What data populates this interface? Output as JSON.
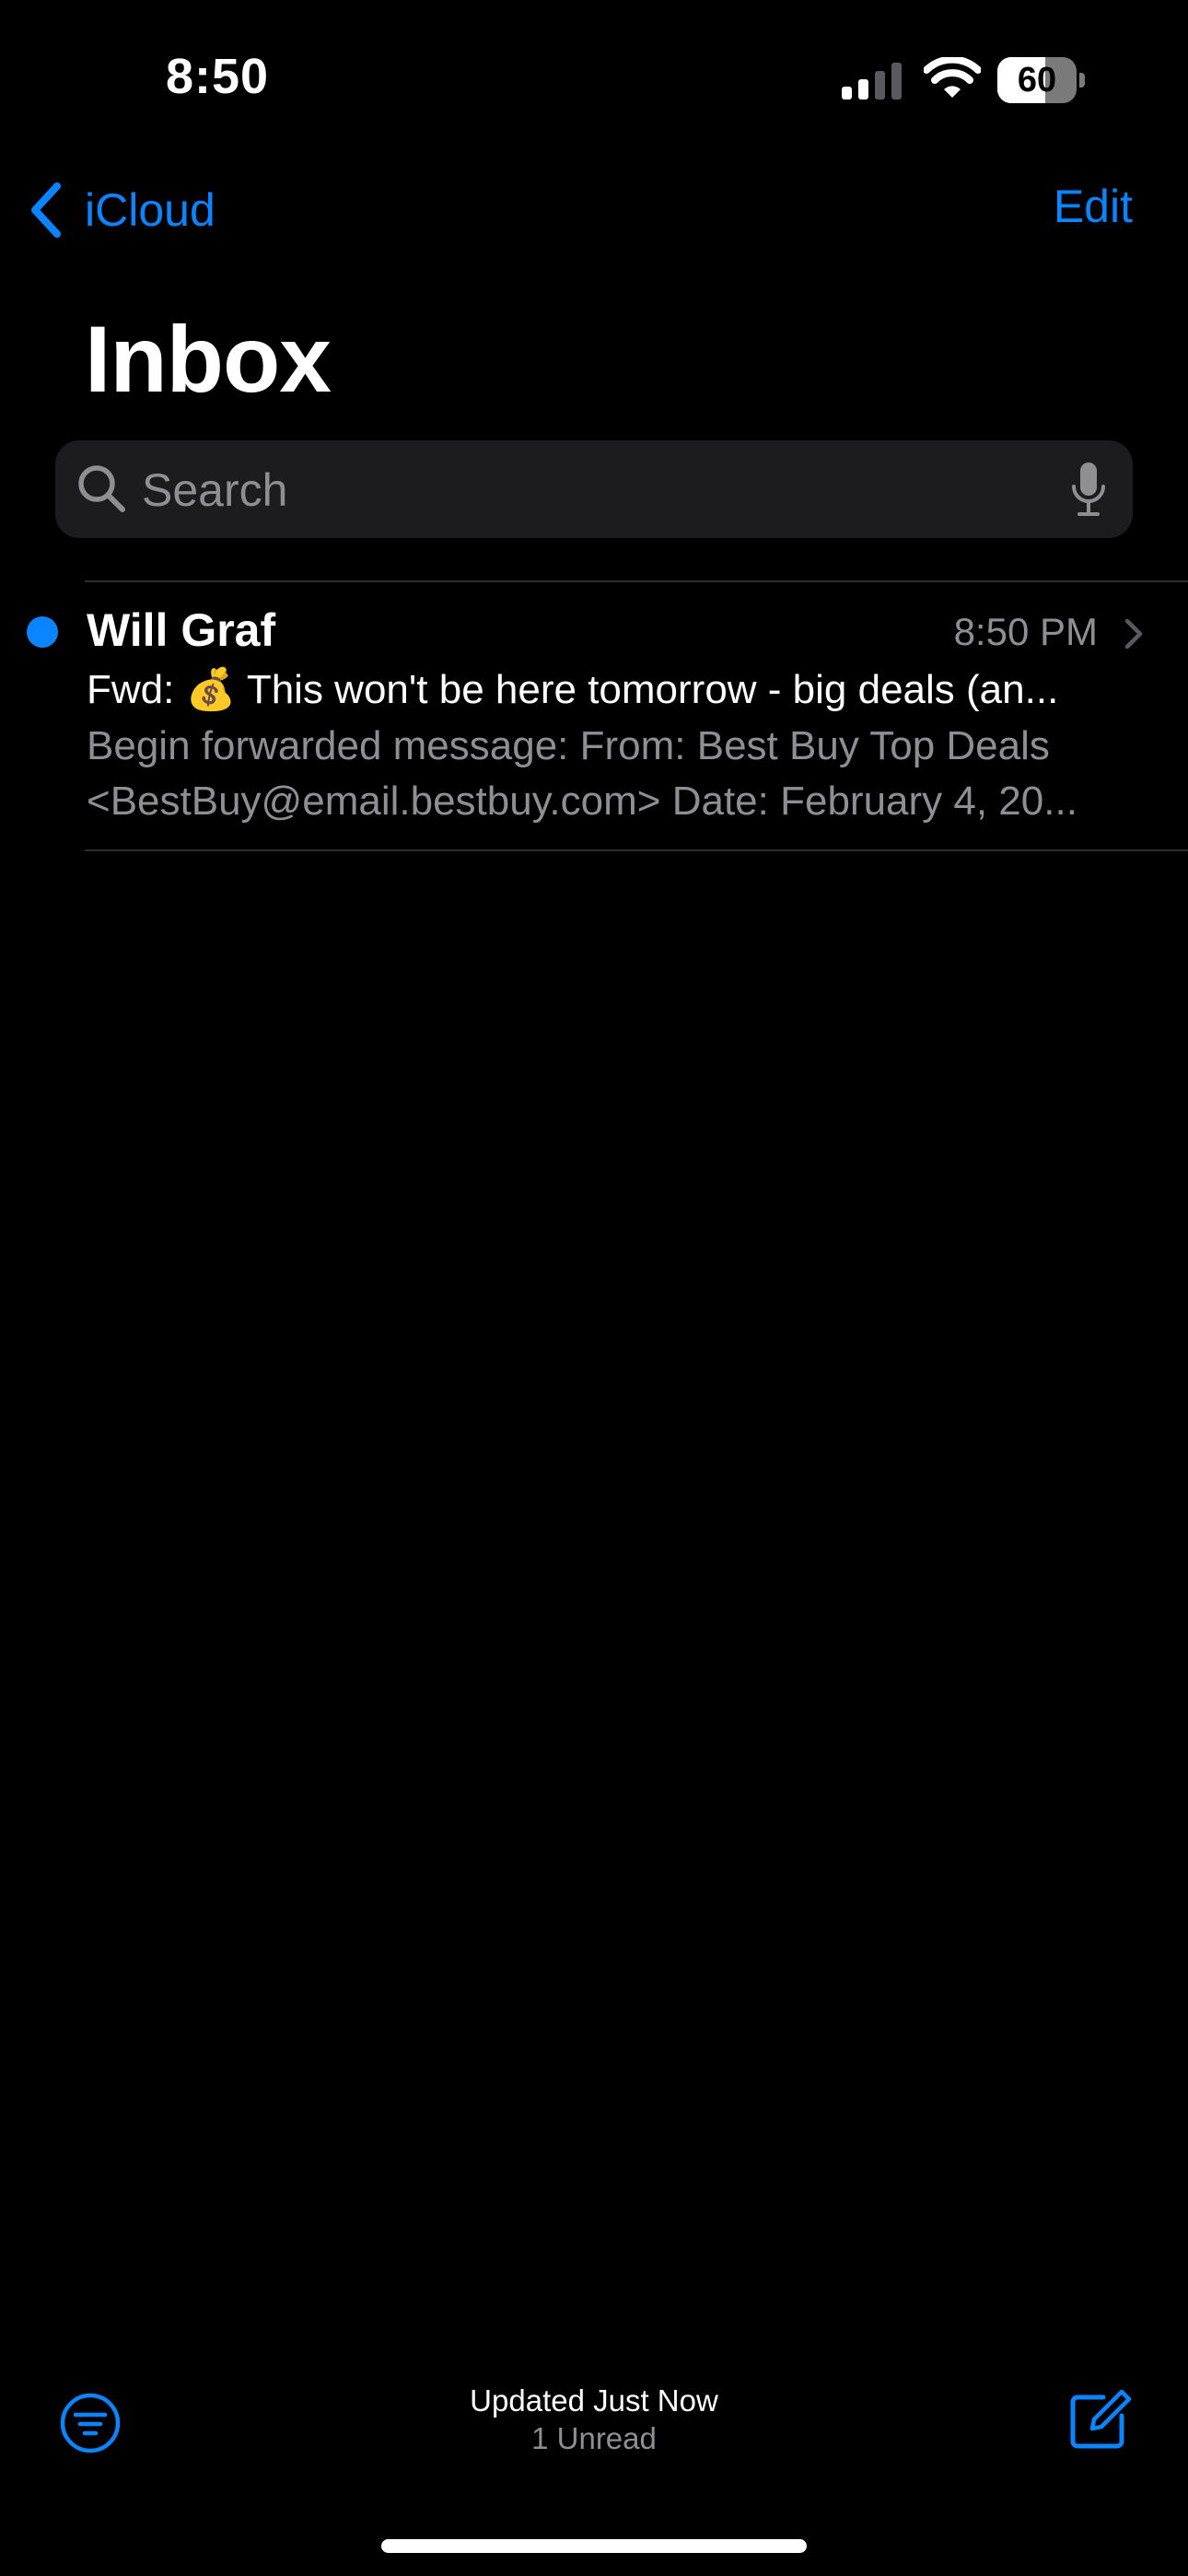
{
  "status_bar": {
    "time": "8:50",
    "battery_level": "60",
    "battery_fraction": 0.6
  },
  "nav": {
    "back_label": "iCloud",
    "edit_label": "Edit"
  },
  "page": {
    "title": "Inbox"
  },
  "search": {
    "placeholder": "Search"
  },
  "messages": [
    {
      "sender": "Will Graf",
      "time": "8:50 PM",
      "unread": true,
      "subject_prefix": "Fwd:",
      "subject_emoji": "💰",
      "subject_text": "This won't be here tomorrow - big deals (an...",
      "preview_line1": "Begin forwarded message: From: Best Buy Top Deals",
      "preview_line2": "<BestBuy@email.bestbuy.com> Date: February 4, 20..."
    }
  ],
  "toolbar": {
    "status": "Updated Just Now",
    "unread_count": "1 Unread"
  },
  "colors": {
    "accent": "#0a84ff",
    "background": "#000000",
    "secondary_text": "#8e8e93",
    "search_background": "#1c1c1e"
  },
  "icons": {
    "back": "chevron-left-icon",
    "search": "search-icon",
    "mic": "microphone-icon",
    "row": "chevron-right-icon",
    "filter": "filter-icon",
    "compose": "compose-icon"
  }
}
